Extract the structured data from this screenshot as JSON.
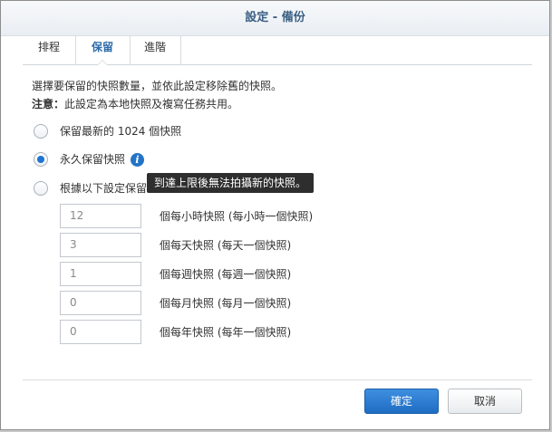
{
  "dialog": {
    "title": "設定 - 備份"
  },
  "tabs": [
    {
      "label": "排程",
      "active": false
    },
    {
      "label": "保留",
      "active": true
    },
    {
      "label": "進階",
      "active": false
    }
  ],
  "description": {
    "line1": "選擇要保留的快照數量，並依此設定移除舊的快照。",
    "note_prefix": "注意：",
    "note_text": "此設定為本地快照及複寫任務共用。"
  },
  "options": [
    {
      "label": "保留最新的 1024 個快照",
      "checked": false
    },
    {
      "label": "永久保留快照",
      "checked": true
    },
    {
      "label": "根據以下設定保留",
      "checked": false
    }
  ],
  "tooltip": "到達上限後無法拍攝新的快照。",
  "retention_fields": [
    {
      "value": "12",
      "label": "個每小時快照 (每小時一個快照)"
    },
    {
      "value": "3",
      "label": "個每天快照 (每天一個快照)"
    },
    {
      "value": "1",
      "label": "個每週快照 (每週一個快照)"
    },
    {
      "value": "0",
      "label": "個每月快照 (每月一個快照)"
    },
    {
      "value": "0",
      "label": "個每年快照 (每年一個快照)"
    }
  ],
  "buttons": {
    "ok": "確定",
    "cancel": "取消"
  },
  "colors": {
    "accent": "#2b6aa8",
    "primary_button": "#2b7fd4",
    "title_text": "#3b5f84"
  }
}
